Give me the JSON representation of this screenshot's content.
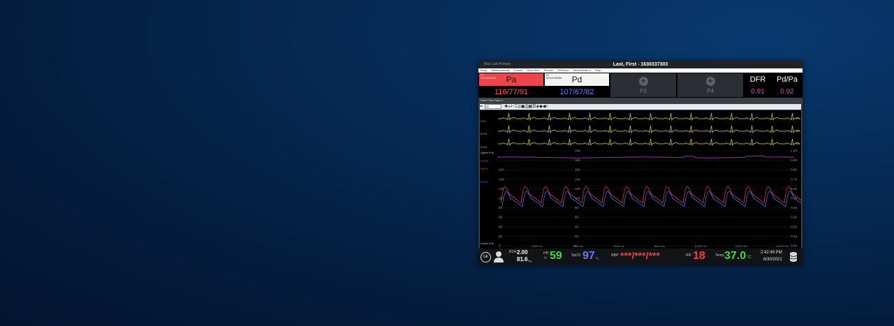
{
  "window": {
    "title": "Last, First - 1630337303",
    "left_caption": "Mac-Lab  Primary"
  },
  "menu": [
    "Study",
    "Measurements",
    "Events",
    "Real-Time",
    "Review",
    "Windows",
    "Administration",
    "Help"
  ],
  "tiles": {
    "p1": {
      "tag": "P1",
      "sub": "SENSOR/MM",
      "name": "Pa",
      "value": "116/77/91",
      "value_color": "#ff5b5b"
    },
    "p2": {
      "tag": "P2",
      "sub": "SENSOR/MM",
      "name": "Pd",
      "value": "107/67/82",
      "value_color": "#6f7cff"
    },
    "p3": {
      "name": "P3"
    },
    "p4": {
      "name": "P4"
    },
    "dfr": {
      "name": "DFR",
      "value": "0.91"
    },
    "pdpa": {
      "name": "Pd/Pa",
      "value": "0.92"
    }
  },
  "waveform": {
    "page_tab": "Real-Time Page 1",
    "toolbar_zoom": "25",
    "leads": [
      "I  0.1",
      "II  0.0",
      "V  0.0"
    ],
    "sweep_label": "Upper Full",
    "channel_labels": [
      "Pd/Pa",
      "Pa 24",
      "Pd 24"
    ],
    "bottom_label": "Lower Full",
    "scale_left": [
      "160",
      "140",
      "120",
      "100",
      "80",
      "60",
      "40",
      "20",
      "0"
    ],
    "scale_mid": [
      "200",
      "180",
      "160",
      "140",
      "120",
      "100",
      "80",
      "60",
      "40",
      "20",
      "0"
    ],
    "scale_right": [
      "1.00",
      "0.90",
      "0.80",
      "0.70",
      "0.60",
      "0.50",
      "0.40",
      "0.30",
      "0.20",
      "0.10",
      "0.00"
    ],
    "time_ticks": [
      "2000 ms",
      "4000 ms",
      "6000 ms",
      "8000 ms",
      "10000 ms",
      "12000 ms",
      "14000 ms"
    ],
    "colors": {
      "ecg": "#d8d35a",
      "ratio": "#c23bd4",
      "pa": "#e0404e",
      "pd": "#5270f0"
    }
  },
  "status": {
    "logo": "GE",
    "bsa_label": "BSA:",
    "bsa_value": "2.00",
    "weight_value": "81.6",
    "weight_unit": "Kg",
    "hr_label": "HR:",
    "hr_sub": "(I)",
    "hr_value": "59",
    "spo2_label": "SpO2:",
    "spo2_value": "97",
    "spo2_unit": "%",
    "nbp_label": "NBP:",
    "nbp_value": "***/***/***",
    "rr_label": "RR:",
    "rr_value": "18",
    "temp_label": "Temp:",
    "temp_value": "37.0",
    "temp_unit": "°C",
    "time": "2:42:49 PM",
    "date": "8/30/2021"
  }
}
